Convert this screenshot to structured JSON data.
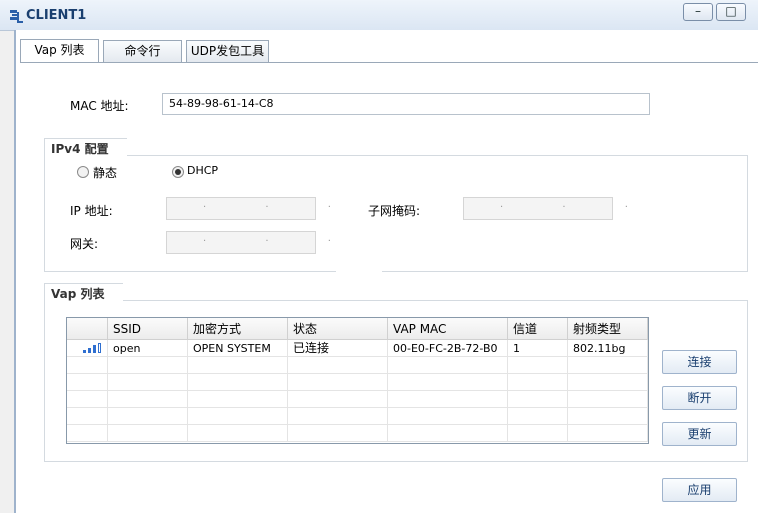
{
  "window": {
    "title": "CLIENT1",
    "minimize_glyph": "–",
    "maximize_glyph": "□"
  },
  "tabs": [
    {
      "label": "Vap 列表",
      "active": true
    },
    {
      "label": "命令行",
      "active": false
    },
    {
      "label": "UDP发包工具",
      "active": false
    }
  ],
  "mac": {
    "label": "MAC 地址:",
    "value": "54-89-98-61-14-C8"
  },
  "ipv4": {
    "section_title": "IPv4 配置",
    "static_label": "静态",
    "dhcp_label": "DHCP",
    "selected": "DHCP",
    "ip_label": "IP 地址:",
    "ip_value": "· · ·",
    "mask_label": "子网掩码:",
    "mask_value": "· · ·",
    "gateway_label": "网关:",
    "gateway_value": "· · ·"
  },
  "vap": {
    "section_title": "Vap 列表",
    "columns": [
      "SSID",
      "加密方式",
      "状态",
      "VAP MAC",
      "信道",
      "射频类型"
    ],
    "rows": [
      {
        "signal_level": 0.75,
        "ssid": "open",
        "encryption": "OPEN SYSTEM",
        "status": "已连接",
        "vap_mac": "00-E0-FC-2B-72-B0",
        "channel": "1",
        "radio_type": "802.11bg"
      }
    ],
    "connect_label": "连接",
    "disconnect_label": "断开",
    "refresh_label": "更新"
  },
  "apply_label": "应用",
  "colors": {
    "title_text": "#1a3f6f",
    "signal": "#2f6fd0"
  }
}
